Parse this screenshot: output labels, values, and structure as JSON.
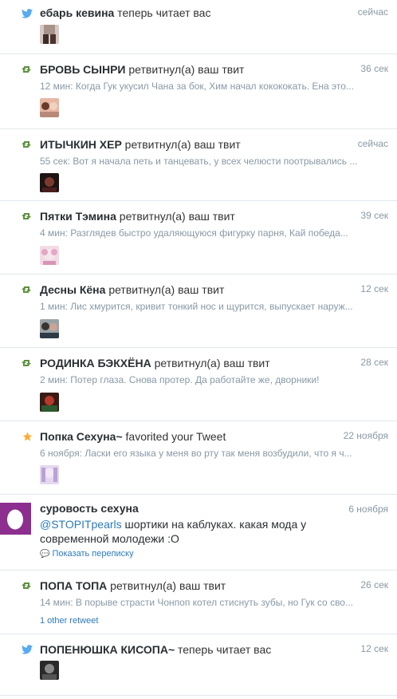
{
  "colors": {
    "twitter_blue": "#55acee",
    "retweet_green": "#5c913b",
    "favorite_gold": "#ffac33",
    "egg_purple": "#8c2f8e"
  },
  "notifications": [
    {
      "type": "follow",
      "icon": "twitter-bird-icon",
      "name": "ебарь кевина",
      "action": "теперь читает вас",
      "time": "сейчас",
      "snippet": ""
    },
    {
      "type": "retweet",
      "icon": "retweet-icon",
      "name": "БРОВЬ СЫНРИ",
      "action": "ретвитнул(а) ваш твит",
      "time": "36 сек",
      "snippet": "12 мин: Когда Гук укусил Чана за бок, Хим начал кокококать. Ена это..."
    },
    {
      "type": "retweet",
      "icon": "retweet-icon",
      "name": "ИТЫЧКИН ХЕР",
      "action": "ретвитнул(а) ваш твит",
      "time": "сейчас",
      "snippet": "55 сек: Вот я начала петь и танцевать, у всех челюсти поотрывались ..."
    },
    {
      "type": "retweet",
      "icon": "retweet-icon",
      "name": "Пятки Тэмина",
      "action": "ретвитнул(а) ваш твит",
      "time": "39 сек",
      "snippet": "4 мин: Разглядев быстро удаляющуюся фигурку парня, Кай победа..."
    },
    {
      "type": "retweet",
      "icon": "retweet-icon",
      "name": "Десны Кёна",
      "action": "ретвитнул(а) ваш твит",
      "time": "12 сек",
      "snippet": "1 мин: Лис хмурится, кривит тонкий нос и щурится, выпускает наруж..."
    },
    {
      "type": "retweet",
      "icon": "retweet-icon",
      "name": "РОДИНКА БЭКХЁНА",
      "action": "ретвитнул(а) ваш твит",
      "time": "28 сек",
      "snippet": "2 мин: Потер глаза. Снова протер. Да работайте же, дворники!"
    },
    {
      "type": "favorite",
      "icon": "star-icon",
      "name": "Попка Сехуна~",
      "action": "favorited your Tweet",
      "time": "22 ноября",
      "snippet": "6 ноября: Ласки его языка у меня во рту так меня возбудили, что я ч..."
    },
    {
      "type": "conversation",
      "name": "суровость сехуна",
      "time": "6 ноября",
      "mention": "@STOPITpearls",
      "text": " шортики на каблуках. какая мода у современной молодежи :О",
      "show_conversation": "Показать переписку"
    },
    {
      "type": "retweet",
      "icon": "retweet-icon",
      "name": "ПОПА ТОПА",
      "action": "ретвитнул(а) ваш твит",
      "time": "26 сек",
      "snippet": "14 мин: В порыве страсти Чонпоп котел стиснуть зубы, но Гук со сво...",
      "extra": "1 other retweet"
    },
    {
      "type": "follow",
      "icon": "twitter-bird-icon",
      "name": "ПОПЕНЮШКА КИСОПА~",
      "action": "теперь читает вас",
      "time": "12 сек",
      "snippet": ""
    }
  ]
}
